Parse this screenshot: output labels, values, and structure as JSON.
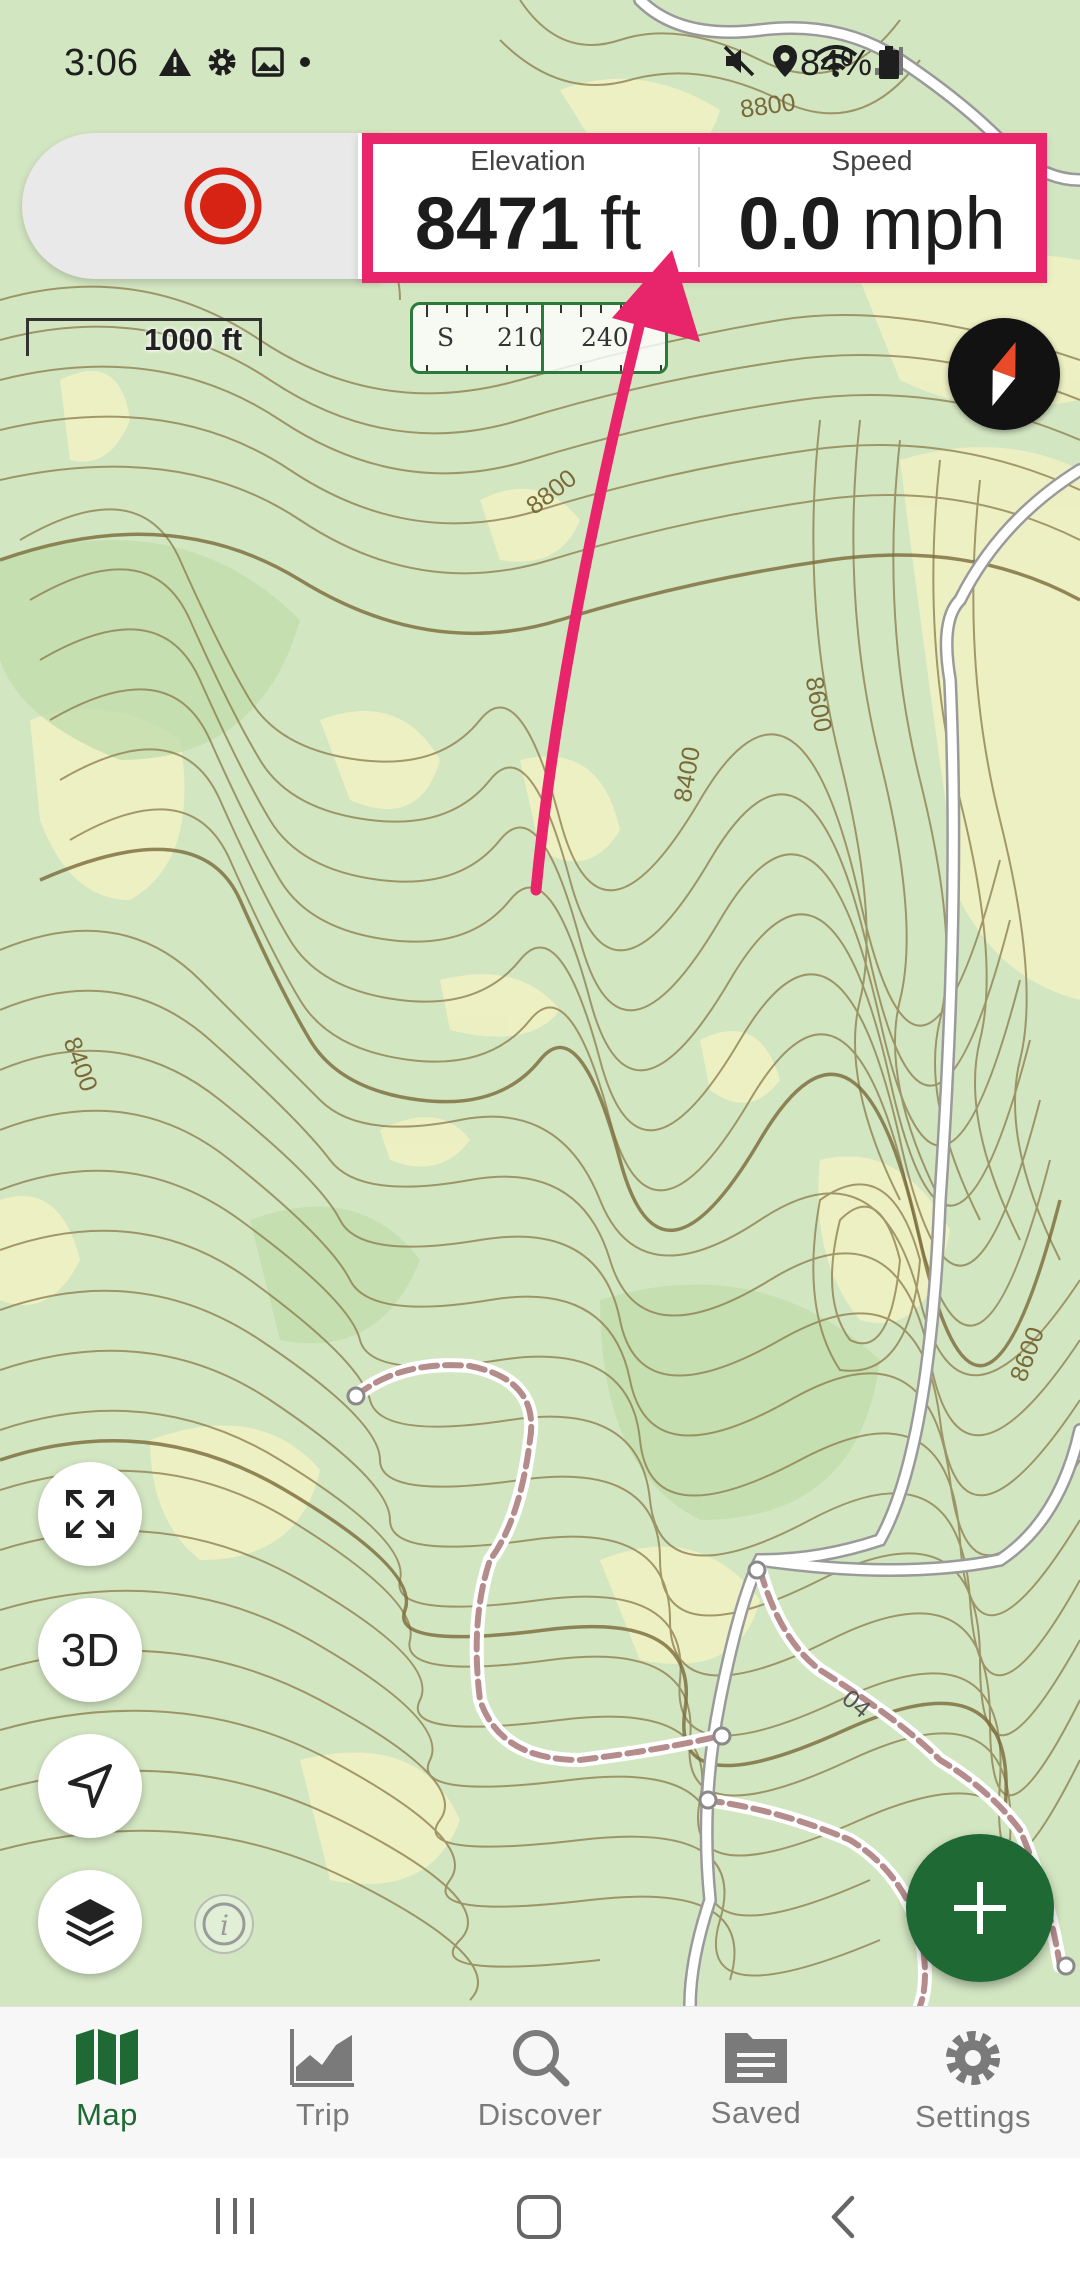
{
  "status_bar": {
    "time": "3:06",
    "left_icons": [
      "warning-icon",
      "gear-icon",
      "image-icon",
      "dot-icon"
    ],
    "right_icons": [
      "mute-icon",
      "location-icon",
      "wifi-icon",
      "signal-icon",
      "battery-icon"
    ],
    "battery": "84%"
  },
  "hud": {
    "elevation": {
      "label": "Elevation",
      "value": "8471",
      "unit": "ft"
    },
    "speed": {
      "label": "Speed",
      "value": "0.0",
      "unit": "mph"
    },
    "record_color": "#d62314",
    "highlight_color": "#e8246a"
  },
  "map": {
    "scale_label": "1000 ft",
    "heading_strip": {
      "cardinal": "S",
      "ticks": [
        "210",
        "240"
      ]
    },
    "contour_labels": [
      "8800",
      "8800",
      "8600",
      "8400",
      "8400",
      "8600",
      "04"
    ],
    "colors": {
      "base": "#d8e8c9",
      "forest": "#c4deb0",
      "open": "#eef0c2",
      "contour": "#8a7a4a",
      "road": "#ffffff",
      "trail": "#b48c8c"
    }
  },
  "controls": {
    "fullscreen_icon": "expand-icon",
    "threeD_label": "3D",
    "locate_icon": "navigation-arrow-icon",
    "layers_icon": "layers-icon",
    "attribution_icon": "info-icon",
    "add_icon": "plus-icon"
  },
  "bottom_nav": {
    "items": [
      {
        "label": "Map",
        "icon": "map-icon",
        "active": true
      },
      {
        "label": "Trip",
        "icon": "trip-chart-icon",
        "active": false
      },
      {
        "label": "Discover",
        "icon": "search-icon",
        "active": false
      },
      {
        "label": "Saved",
        "icon": "folder-icon",
        "active": false
      },
      {
        "label": "Settings",
        "icon": "gear-icon",
        "active": false
      }
    ]
  }
}
